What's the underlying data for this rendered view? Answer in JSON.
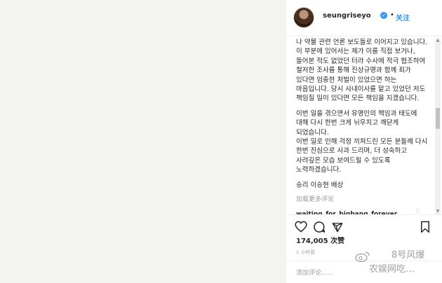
{
  "post": {
    "username": "seungriseyo",
    "verified_icon": "verified-badge-icon",
    "follow_separator": "•",
    "follow_label": "关注",
    "caption_paragraphs": [
      "나 약물 관련 언론 보도들로 이어지고 있습니다. 이 부분에 있어서는 제가 이를 직접 보거나, 들어본 적도 없었던 터라 수사에 적극 협조하여 철저한 조사를 통해 진상규명과 함께 죄가 있다면 엄중한 처벌이 있었으면 하는 마음입니다. 당시 사내이사를 맡고 있었던 저도 책임질 일이 있다면 모든 책임을 지겠습니다.",
      "이번 일을 겪으면서 유명인의 책임과 태도에 대해 다시 한번 크게 뉘우치고 깨닫게 되었습니다.\n이번 일로 인해 걱정 끼쳐드린 모든 분들께 다시 한번 진심으로 사과 드리며, 더 성숙하고 사려깊은 모습 보여드릴 수 있도록 노력하겠습니다."
    ],
    "signature": "승리 이승현 배상",
    "load_more_comments": "加载更多评论",
    "first_comment_user": "waiting_for_bigbang_forever",
    "likes": "174,005 次赞",
    "time": "1 小时前",
    "add_comment_placeholder": "添加评论......"
  },
  "watermark": {
    "line1": "8号风爆",
    "line2": "农娱网吃…"
  },
  "icons": {
    "like": "heart-icon",
    "comment": "comment-icon",
    "share": "share-icon",
    "save": "bookmark-icon"
  },
  "colors": {
    "link_blue": "#3897f0",
    "text": "#262626",
    "muted": "#999999"
  }
}
